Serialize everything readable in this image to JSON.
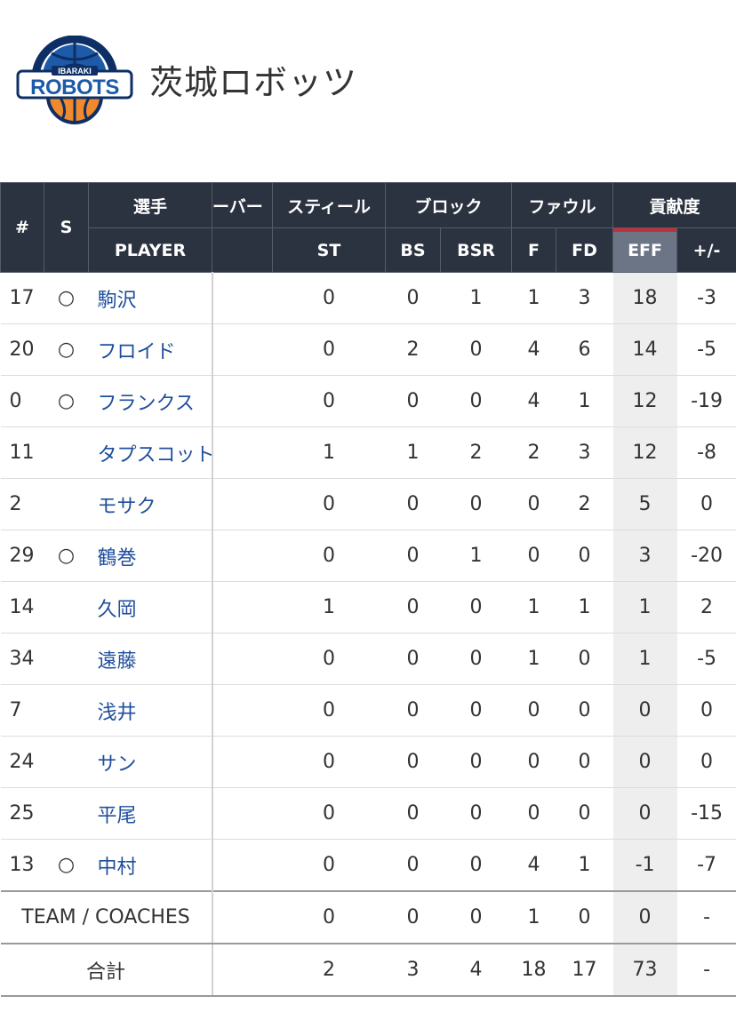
{
  "team": {
    "name": "茨城ロボッツ",
    "logo_text_top": "IBARAKI",
    "logo_text_main": "ROBOTS",
    "logo_colors": {
      "blue": "#1d5ba8",
      "orange": "#f08a2c",
      "dark": "#0e2f66"
    }
  },
  "table": {
    "headers": {
      "num": "#",
      "starter": "S",
      "player_group": "選手",
      "player": "PLAYER",
      "turnover_group_cut": "ーバー",
      "steal_group": "スティール",
      "steal": "ST",
      "block_group": "ブロック",
      "bs": "BS",
      "bsr": "BSR",
      "foul_group": "ファウル",
      "f": "F",
      "fd": "FD",
      "contrib_group": "貢献度",
      "eff": "EFF",
      "pm": "+/-"
    },
    "rows": [
      {
        "num": "17",
        "starter": "○",
        "player": "駒沢",
        "st": "0",
        "bs": "0",
        "bsr": "1",
        "f": "1",
        "fd": "3",
        "eff": "18",
        "pm": "-3"
      },
      {
        "num": "20",
        "starter": "○",
        "player": "フロイド",
        "st": "0",
        "bs": "2",
        "bsr": "0",
        "f": "4",
        "fd": "6",
        "eff": "14",
        "pm": "-5"
      },
      {
        "num": "0",
        "starter": "○",
        "player": "フランクス",
        "st": "0",
        "bs": "0",
        "bsr": "0",
        "f": "4",
        "fd": "1",
        "eff": "12",
        "pm": "-19"
      },
      {
        "num": "11",
        "starter": "",
        "player": "タプスコット",
        "st": "1",
        "bs": "1",
        "bsr": "2",
        "f": "2",
        "fd": "3",
        "eff": "12",
        "pm": "-8"
      },
      {
        "num": "2",
        "starter": "",
        "player": "モサク",
        "st": "0",
        "bs": "0",
        "bsr": "0",
        "f": "0",
        "fd": "2",
        "eff": "5",
        "pm": "0"
      },
      {
        "num": "29",
        "starter": "○",
        "player": "鶴巻",
        "st": "0",
        "bs": "0",
        "bsr": "1",
        "f": "0",
        "fd": "0",
        "eff": "3",
        "pm": "-20"
      },
      {
        "num": "14",
        "starter": "",
        "player": "久岡",
        "st": "1",
        "bs": "0",
        "bsr": "0",
        "f": "1",
        "fd": "1",
        "eff": "1",
        "pm": "2"
      },
      {
        "num": "34",
        "starter": "",
        "player": "遠藤",
        "st": "0",
        "bs": "0",
        "bsr": "0",
        "f": "1",
        "fd": "0",
        "eff": "1",
        "pm": "-5"
      },
      {
        "num": "7",
        "starter": "",
        "player": "浅井",
        "st": "0",
        "bs": "0",
        "bsr": "0",
        "f": "0",
        "fd": "0",
        "eff": "0",
        "pm": "0"
      },
      {
        "num": "24",
        "starter": "",
        "player": "サン",
        "st": "0",
        "bs": "0",
        "bsr": "0",
        "f": "0",
        "fd": "0",
        "eff": "0",
        "pm": "0"
      },
      {
        "num": "25",
        "starter": "",
        "player": "平尾",
        "st": "0",
        "bs": "0",
        "bsr": "0",
        "f": "0",
        "fd": "0",
        "eff": "0",
        "pm": "-15"
      },
      {
        "num": "13",
        "starter": "○",
        "player": "中村",
        "st": "0",
        "bs": "0",
        "bsr": "0",
        "f": "4",
        "fd": "1",
        "eff": "-1",
        "pm": "-7"
      }
    ],
    "team_row": {
      "label": "TEAM / COACHES",
      "st": "0",
      "bs": "0",
      "bsr": "0",
      "f": "1",
      "fd": "0",
      "eff": "0",
      "pm": "-"
    },
    "total_row": {
      "label": "合計",
      "st": "2",
      "bs": "3",
      "bsr": "4",
      "f": "18",
      "fd": "17",
      "eff": "73",
      "pm": "-"
    }
  }
}
